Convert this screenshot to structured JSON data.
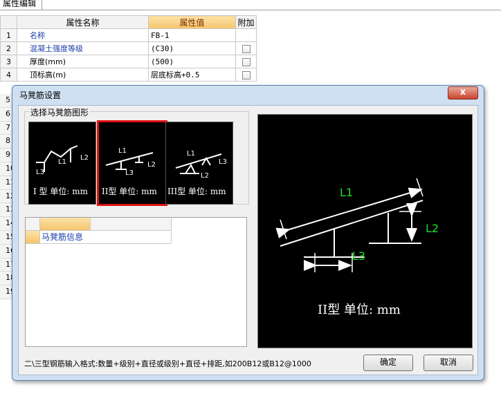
{
  "panel": {
    "tab_label": "属性编辑",
    "headers": {
      "name": "属性名称",
      "value": "属性值",
      "extra": "附加"
    },
    "rows": [
      {
        "num": "1",
        "name": "名称",
        "value": "FB-1",
        "has_checkbox": false
      },
      {
        "num": "2",
        "name": "混凝土强度等级",
        "value": "(C30)",
        "has_checkbox": true
      },
      {
        "num": "3",
        "name": "厚度(mm)",
        "value": "(500)",
        "has_checkbox": true
      },
      {
        "num": "4",
        "name": "顶标高(m)",
        "value": "层底标高+0.5",
        "has_checkbox": true
      }
    ],
    "more_row_numbers": [
      "5",
      "6",
      "7",
      "8",
      "9",
      "10",
      "11",
      "12",
      "13",
      "14",
      "15",
      "16",
      "17",
      "18",
      "19"
    ]
  },
  "dialog": {
    "title": "马凳筋设置",
    "close_label": "x",
    "group_label": "选择马凳筋图形",
    "shapes": [
      {
        "caption": "I 型  单位: mm",
        "labels": [
          "L1",
          "L2",
          "L3"
        ]
      },
      {
        "caption": "II型  单位: mm",
        "labels": [
          "L1",
          "L2",
          "L3"
        ]
      },
      {
        "caption": "III型  单位: mm",
        "labels": [
          "L1",
          "L2",
          "L3"
        ]
      }
    ],
    "selected_shape": 1,
    "info_table": {
      "row_label": "马凳筋信息",
      "row_value": ""
    },
    "preview": {
      "caption": "II型  单位: mm",
      "l1": "L1",
      "l2": "L2",
      "l3": "L3"
    },
    "hint": "二\\三型钢筋输入格式:数量+级别+直径或级别+直径+排距,如200B12或B12@1000",
    "ok_label": "确定",
    "cancel_label": "取消"
  },
  "colors": {
    "label_green": "#22e022",
    "selected_border": "#e01010",
    "header_orange": "#f5c46c"
  }
}
